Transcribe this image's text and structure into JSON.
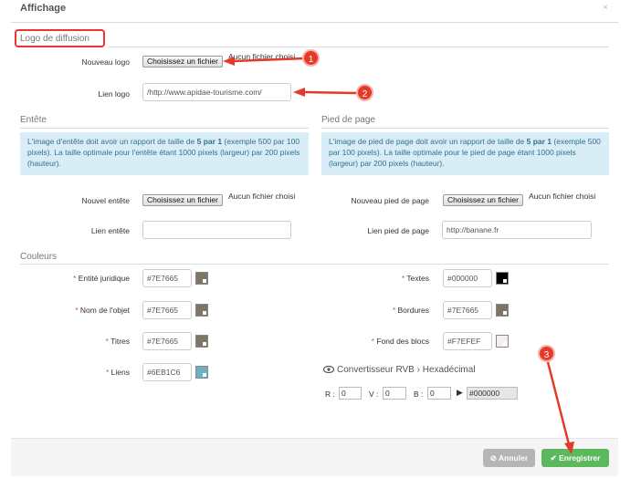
{
  "modal": {
    "title": "Affichage",
    "close": "×"
  },
  "logo_section": {
    "title": "Logo de diffusion",
    "new_logo_label": "Nouveau logo",
    "file_button": "Choisissez un fichier",
    "no_file": "Aucun fichier choisi",
    "link_label": "Lien logo",
    "link_value": "/http://www.apidae-tourisme.com/"
  },
  "header_section": {
    "title": "Entête",
    "info_parts": [
      "L'image d'entête doit avoir un rapport de taille de ",
      "5 par 1",
      " (exemple 500 par 100 pixels). La taille optimale pour l'entête étant 1000 pixels (largeur) par 200 pixels (hauteur)."
    ],
    "new_label": "Nouvel entête",
    "file_button": "Choisissez un fichier",
    "no_file": "Aucun fichier choisi",
    "link_label": "Lien entête",
    "link_value": ""
  },
  "footer_section": {
    "title": "Pied de page",
    "info_parts": [
      "L'image de pied de page doit avoir un rapport de taille de ",
      "5 par 1",
      " (exemple 500 par 100 pixels). La taille optimale pour le pied de page étant 1000 pixels (largeur) par 200 pixels (hauteur)."
    ],
    "new_label": "Nouveau pied de page",
    "file_button": "Choisissez un fichier",
    "no_file": "Aucun fichier choisi",
    "link_label": "Lien pied de page",
    "link_value": "http://banane.fr"
  },
  "colors_section": {
    "title": "Couleurs",
    "required_mark": "*",
    "left": [
      {
        "label": "Entité juridique",
        "value": "#7E7665",
        "color": "#7E7665"
      },
      {
        "label": "Nom de l'objet",
        "value": "#7E7665",
        "color": "#7E7665"
      },
      {
        "label": "Titres",
        "value": "#7E7665",
        "color": "#7E7665"
      },
      {
        "label": "Liens",
        "value": "#6EB1C6",
        "color": "#6EB1C6"
      }
    ],
    "right": [
      {
        "label": "Textes",
        "value": "#000000",
        "color": "#000000"
      },
      {
        "label": "Bordures",
        "value": "#7E7665",
        "color": "#7E7665"
      },
      {
        "label": "Fond des blocs",
        "value": "#F7EFEF",
        "color": "#F7EFEF"
      }
    ]
  },
  "converter": {
    "title": "Convertisseur RVB › Hexadécimal",
    "r_label": "R :",
    "r_value": "0",
    "v_label": "V :",
    "v_value": "0",
    "b_label": "B :",
    "b_value": "0",
    "arrow": "▶",
    "result": "#000000"
  },
  "buttons": {
    "cancel": "Annuler",
    "save": "Enregistrer"
  },
  "annotations": [
    "1",
    "2",
    "3"
  ],
  "colors": {
    "annotation_red": "#e33a2a",
    "info_bg": "#d9edf7",
    "save_green": "#5cb85c",
    "cancel_gray": "#b5b5b5"
  }
}
